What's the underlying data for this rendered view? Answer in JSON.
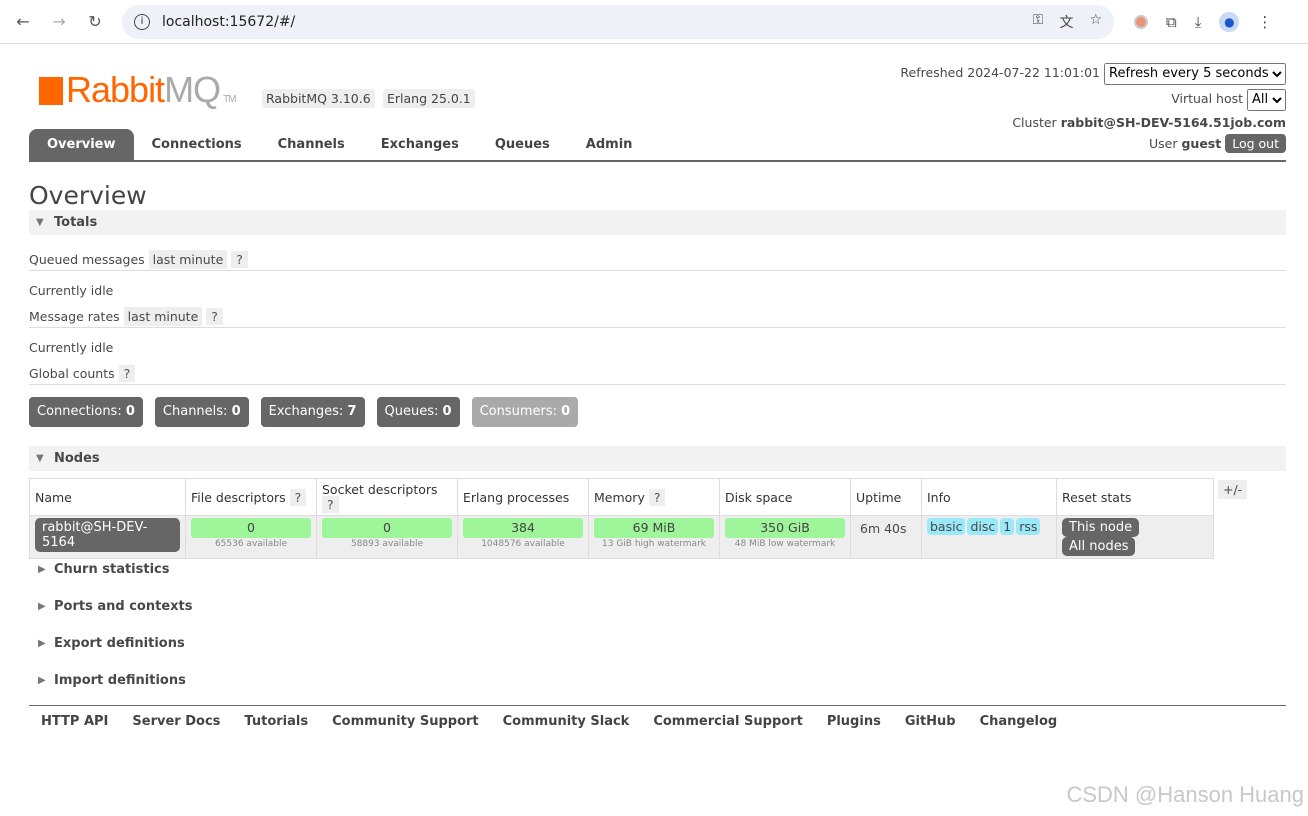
{
  "browser": {
    "url": "localhost:15672/#/"
  },
  "header": {
    "logo_text_a": "Rabbit",
    "logo_text_b": "MQ",
    "logo_tm": "TM",
    "rabbitmq_version": "RabbitMQ 3.10.6",
    "erlang_version": "Erlang 25.0.1",
    "refreshed_label": "Refreshed",
    "refreshed_time": "2024-07-22 11:01:01",
    "refresh_select": "Refresh every 5 seconds",
    "vhost_label": "Virtual host",
    "vhost_select": "All",
    "cluster_label": "Cluster",
    "cluster_name": "rabbit@SH-DEV-5164.51job.com",
    "user_label": "User",
    "user_name": "guest",
    "logout": "Log out"
  },
  "tabs": [
    "Overview",
    "Connections",
    "Channels",
    "Exchanges",
    "Queues",
    "Admin"
  ],
  "page_title": "Overview",
  "totals": {
    "title": "Totals",
    "queued_label": "Queued messages",
    "queued_range": "last minute",
    "help": "?",
    "idle1": "Currently idle",
    "rates_label": "Message rates",
    "rates_range": "last minute",
    "idle2": "Currently idle",
    "global_label": "Global counts",
    "counts": [
      {
        "label": "Connections:",
        "value": "0"
      },
      {
        "label": "Channels:",
        "value": "0"
      },
      {
        "label": "Exchanges:",
        "value": "7"
      },
      {
        "label": "Queues:",
        "value": "0"
      },
      {
        "label": "Consumers:",
        "value": "0"
      }
    ]
  },
  "nodes": {
    "title": "Nodes",
    "plusminus": "+/-",
    "headers": [
      "Name",
      "File descriptors",
      "Socket descriptors",
      "Erlang processes",
      "Memory",
      "Disk space",
      "Uptime",
      "Info",
      "Reset stats"
    ],
    "row": {
      "name": "rabbit@SH-DEV-5164",
      "fd": "0",
      "fd_sub": "65536 available",
      "sd": "0",
      "sd_sub": "58893 available",
      "ep": "384",
      "ep_sub": "1048576 available",
      "mem": "69 MiB",
      "mem_sub": "13 GiB high watermark",
      "disk": "350 GiB",
      "disk_sub": "48 MiB low watermark",
      "uptime": "6m 40s",
      "info": [
        "basic",
        "disc",
        "1",
        "rss"
      ],
      "reset_this": "This node",
      "reset_all": "All nodes"
    }
  },
  "collapsed": [
    "Churn statistics",
    "Ports and contexts",
    "Export definitions",
    "Import definitions"
  ],
  "footer": [
    "HTTP API",
    "Server Docs",
    "Tutorials",
    "Community Support",
    "Community Slack",
    "Commercial Support",
    "Plugins",
    "GitHub",
    "Changelog"
  ],
  "watermark": "CSDN @Hanson Huang",
  "colors": {
    "brand": "#ff6600",
    "bar_ok": "#9ef59a",
    "info_tag": "#9be8f8",
    "dark": "#666666"
  }
}
